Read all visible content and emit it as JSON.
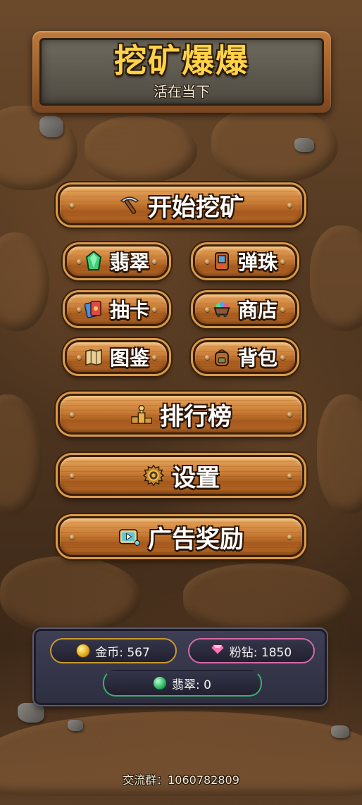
{
  "title": {
    "main": "挖矿爆爆",
    "subtitle": "活在当下"
  },
  "menu": {
    "start_mining": "开始挖矿",
    "emerald": "翡翠",
    "marbles": "弹珠",
    "draw_card": "抽卡",
    "shop": "商店",
    "codex": "图鉴",
    "backpack": "背包",
    "leaderboard": "排行榜",
    "settings": "设置",
    "ad_reward": "广告奖励"
  },
  "resources": {
    "gold": "金币: 567",
    "pink_diamond": "粉钻: 1850",
    "emerald": "翡翠: 0"
  },
  "footer": {
    "group": "交流群：1060782809"
  },
  "colors": {
    "title_gold": "#ffd24a",
    "wood": "#c77a33",
    "gold_border": "#c99a2e",
    "pink_border": "#d86aa6",
    "green_border": "#3fae6a"
  }
}
